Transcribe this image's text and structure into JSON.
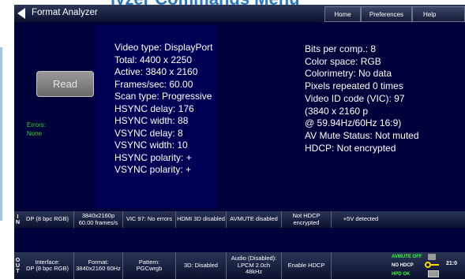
{
  "page_heading": "lyzer Commands Menu",
  "titlebar": {
    "title": "Format Analyzer",
    "nav": {
      "home": "Home",
      "preferences": "Preferences",
      "help": "Help"
    }
  },
  "read_button_label": "Read",
  "errors": {
    "label": "Errors:",
    "value": "None"
  },
  "video_info": [
    "Video type: DisplayPort",
    "Total: 4400 x 2250",
    "Active: 3840 x 2160",
    "Frames/sec: 60.00",
    "Scan type: Progressive",
    "HSYNC delay: 176",
    "HSYNC width: 88",
    "VSYNC delay: 8",
    "VSYNC width: 10",
    "HSYNC polarity: +",
    "VSYNC polarity: +"
  ],
  "signal_info": [
    "Bits per comp.: 8",
    "Color space: RGB",
    "Colorimetry: No data",
    "Pixels repeated 0 times",
    "Video ID code (VIC): 97",
    "(3840 x 2160 p",
    "@ 59.94Hz/60Hz 16:9)",
    "AV Mute Status: Not muted",
    "HDCP: Not encrypted"
  ],
  "in_row": {
    "tag": [
      "I",
      "N"
    ],
    "cells": [
      [
        "DP (8 bpc RGB)"
      ],
      [
        "3840x2160p",
        "60.00 frames/s"
      ],
      [
        "VIC 97: No errors"
      ],
      [
        "HDMI 3D disabled"
      ],
      [
        "AVMUTE disabled"
      ],
      [
        "Not HDCP",
        "encrypted"
      ],
      [
        "+5V detected"
      ]
    ]
  },
  "out_row": {
    "tag": [
      "O",
      "U",
      "T"
    ],
    "cells": [
      [
        "Interface:",
        "DP (8 bpc RGB)"
      ],
      [
        "Format:",
        "3840x2160 60Hz"
      ],
      [
        "Pattern:",
        "PGCwrgb"
      ],
      [
        "3D: Disabled"
      ],
      [
        "Audio (Disabled):",
        "LPCM 2.0ch",
        "48kHz"
      ],
      [
        "Enable HDCP"
      ]
    ],
    "status": {
      "avmute": "AVMUTE OFF",
      "hdcp": "NO HDCP",
      "hpd": "HPD OK",
      "time": "21:0"
    }
  },
  "colors": {
    "screen_bg": "#00003a",
    "panel_bg": "#000055",
    "status_green": "#33cc33",
    "heading_blue": "#2b79c2"
  },
  "icons": [
    "back-arrow-icon",
    "audio-speaker-icon",
    "hdcp-key-icon",
    "monitor-icon"
  ]
}
